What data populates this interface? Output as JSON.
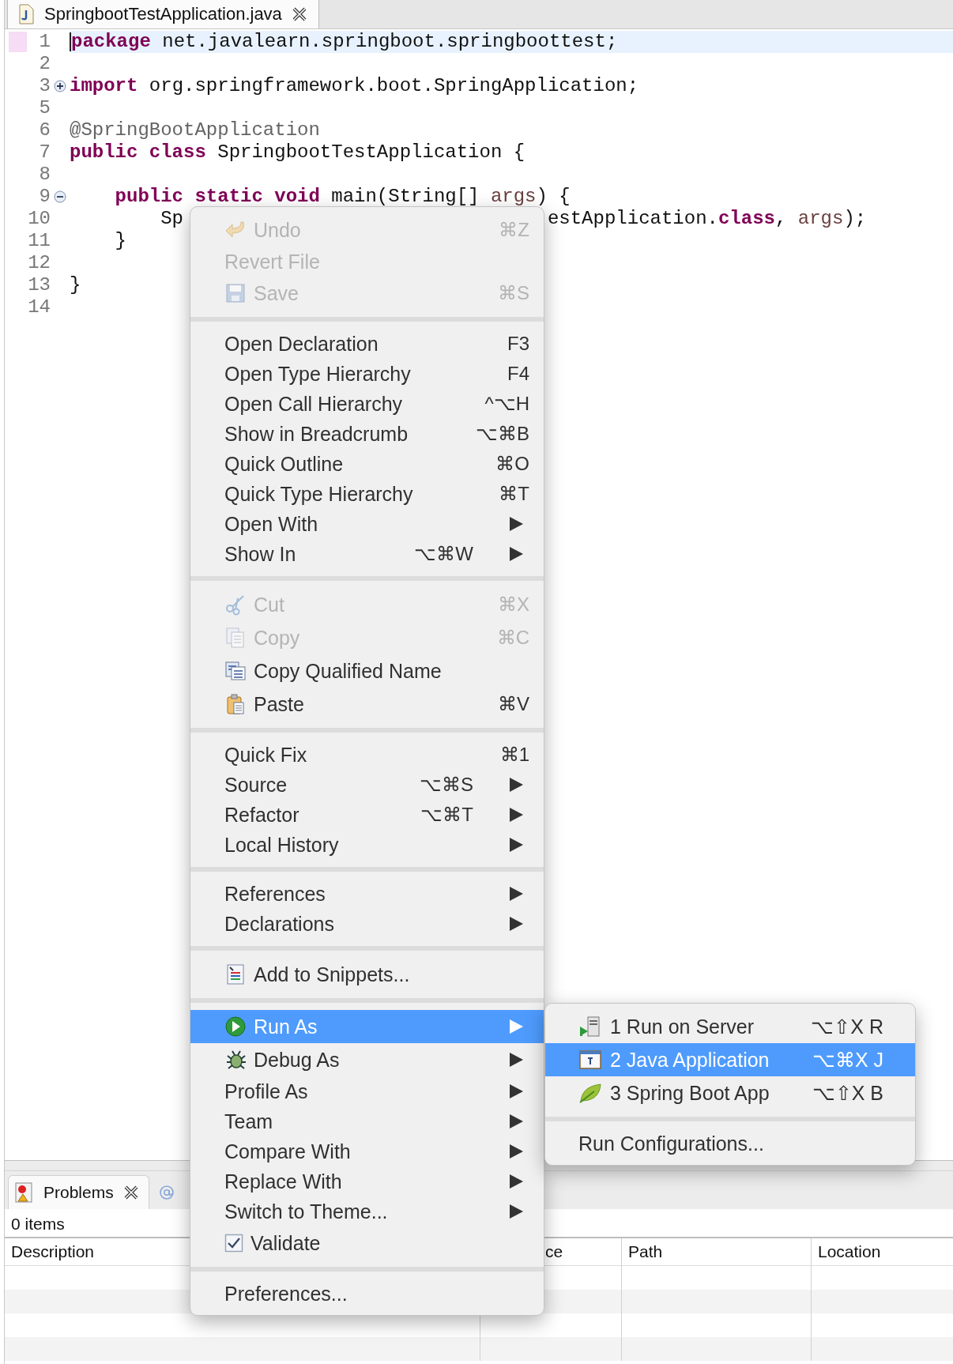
{
  "editor": {
    "tab": {
      "title": "SpringbootTestApplication.java",
      "selected": true
    },
    "lines": [
      {
        "number": "1",
        "current": true,
        "fragments": [
          [
            {
              "text": "package",
              "kind": "keyword"
            },
            {
              "text": " net.javalearn.springboot.springboottest;",
              "kind": "plain"
            }
          ]
        ]
      },
      {
        "number": "2"
      },
      {
        "number": "3",
        "collapsed": true,
        "fragments": [
          [
            {
              "text": "import",
              "kind": "keyword"
            },
            {
              "text": " org.springframework.boot.SpringApplication;",
              "kind": "plain"
            }
          ]
        ]
      },
      {
        "number": "5"
      },
      {
        "number": "6",
        "fragments": [
          [
            {
              "text": "@SpringBootApplication",
              "kind": "annotation"
            }
          ]
        ]
      },
      {
        "number": "7",
        "fragments": [
          [
            {
              "text": "public class",
              "kind": "keyword"
            },
            {
              "text": " SpringbootTestApplication {",
              "kind": "plain"
            }
          ]
        ]
      },
      {
        "number": "8"
      },
      {
        "number": "9",
        "collapsed": false,
        "fragments": [
          [
            {
              "text": "public static void",
              "kind": "keyword"
            },
            {
              "text": " main(String[] ",
              "kind": "plain"
            },
            {
              "text": "args",
              "kind": "param"
            },
            {
              "text": ") {",
              "kind": "plain"
            }
          ]
        ]
      },
      {
        "number": "10",
        "fragments": [
          [
            {
              "text": "Sp",
              "kind": "plain"
            }
          ],
          [
            {
              "text": "estApplication.",
              "kind": "plain"
            },
            {
              "text": "class",
              "kind": "keyword"
            },
            {
              "text": ", ",
              "kind": "plain"
            },
            {
              "text": "args",
              "kind": "param"
            },
            {
              "text": ");",
              "kind": "plain"
            }
          ]
        ]
      },
      {
        "number": "11",
        "fragments": [
          [
            {
              "text": "}",
              "kind": "plain"
            }
          ]
        ]
      },
      {
        "number": "12"
      },
      {
        "number": "13",
        "fragments": [
          [
            {
              "text": "}",
              "kind": "plain"
            }
          ]
        ]
      },
      {
        "number": "14"
      }
    ]
  },
  "context_menu": {
    "sections": [
      {
        "items": [
          {
            "label": "Undo",
            "shortcut": "⌘Z",
            "disabled": true,
            "submenu": false,
            "selected": false
          },
          {
            "label": "Revert File",
            "disabled": true,
            "submenu": false,
            "selected": false
          },
          {
            "label": "Save",
            "shortcut": "⌘S",
            "disabled": true,
            "submenu": false,
            "selected": false
          }
        ]
      },
      {
        "items": [
          {
            "label": "Open Declaration",
            "shortcut": "F3",
            "disabled": false,
            "submenu": false,
            "selected": false
          },
          {
            "label": "Open Type Hierarchy",
            "shortcut": "F4",
            "disabled": false,
            "submenu": false,
            "selected": false
          },
          {
            "label": "Open Call Hierarchy",
            "shortcut": "^⌥H",
            "disabled": false,
            "submenu": false,
            "selected": false
          },
          {
            "label": "Show in Breadcrumb",
            "shortcut": "⌥⌘B",
            "disabled": false,
            "submenu": false,
            "selected": false
          },
          {
            "label": "Quick Outline",
            "shortcut": "⌘O",
            "disabled": false,
            "submenu": false,
            "selected": false
          },
          {
            "label": "Quick Type Hierarchy",
            "shortcut": "⌘T",
            "disabled": false,
            "submenu": false,
            "selected": false
          },
          {
            "label": "Open With",
            "disabled": false,
            "submenu": true,
            "selected": false
          },
          {
            "label": "Show In",
            "shortcut": "⌥⌘W",
            "disabled": false,
            "submenu": true,
            "selected": false
          }
        ]
      },
      {
        "items": [
          {
            "label": "Cut",
            "shortcut": "⌘X",
            "disabled": true,
            "submenu": false,
            "selected": false
          },
          {
            "label": "Copy",
            "shortcut": "⌘C",
            "disabled": true,
            "submenu": false,
            "selected": false
          },
          {
            "label": "Copy Qualified Name",
            "disabled": false,
            "submenu": false,
            "selected": false
          },
          {
            "label": "Paste",
            "shortcut": "⌘V",
            "disabled": false,
            "submenu": false,
            "selected": false
          }
        ]
      },
      {
        "items": [
          {
            "label": "Quick Fix",
            "shortcut": "⌘1",
            "disabled": false,
            "submenu": false,
            "selected": false
          },
          {
            "label": "Source",
            "shortcut": "⌥⌘S",
            "disabled": false,
            "submenu": true,
            "selected": false
          },
          {
            "label": "Refactor",
            "shortcut": "⌥⌘T",
            "disabled": false,
            "submenu": true,
            "selected": false
          },
          {
            "label": "Local History",
            "disabled": false,
            "submenu": true,
            "selected": false
          }
        ]
      },
      {
        "items": [
          {
            "label": "References",
            "disabled": false,
            "submenu": true,
            "selected": false
          },
          {
            "label": "Declarations",
            "disabled": false,
            "submenu": true,
            "selected": false
          }
        ]
      },
      {
        "items": [
          {
            "label": "Add to Snippets...",
            "disabled": false,
            "submenu": false,
            "selected": false
          }
        ]
      },
      {
        "items": [
          {
            "label": "Run As",
            "disabled": false,
            "submenu": true,
            "selected": true
          },
          {
            "label": "Debug As",
            "disabled": false,
            "submenu": true,
            "selected": false
          },
          {
            "label": "Profile As",
            "disabled": false,
            "submenu": true,
            "selected": false
          },
          {
            "label": "Team",
            "disabled": false,
            "submenu": true,
            "selected": false
          },
          {
            "label": "Compare With",
            "disabled": false,
            "submenu": true,
            "selected": false
          },
          {
            "label": "Replace With",
            "disabled": false,
            "submenu": true,
            "selected": false
          },
          {
            "label": "Switch to Theme...",
            "disabled": false,
            "submenu": true,
            "selected": false
          },
          {
            "label": "Validate",
            "kind": "checkbox",
            "checked": true,
            "disabled": false,
            "submenu": false,
            "selected": false
          }
        ]
      },
      {
        "items": [
          {
            "label": "Preferences...",
            "disabled": false,
            "submenu": false,
            "selected": false
          }
        ]
      }
    ]
  },
  "run_as_submenu": {
    "sections": [
      {
        "items": [
          {
            "label": "1 Run on Server",
            "shortcut": "⌥⇧X R",
            "selected": false
          },
          {
            "label": "2 Java Application",
            "shortcut": "⌥⌘X J",
            "selected": true
          },
          {
            "label": "3 Spring Boot App",
            "shortcut": "⌥⇧X B",
            "selected": false
          }
        ]
      },
      {
        "items": [
          {
            "label": "Run Configurations...",
            "selected": false
          }
        ]
      }
    ]
  },
  "problems_view": {
    "tabs": [
      {
        "label": "Problems",
        "selected": true
      },
      {
        "selected": false
      }
    ],
    "summary": "0 items",
    "columns": [
      "Description",
      "ce",
      "Path",
      "Location"
    ]
  }
}
